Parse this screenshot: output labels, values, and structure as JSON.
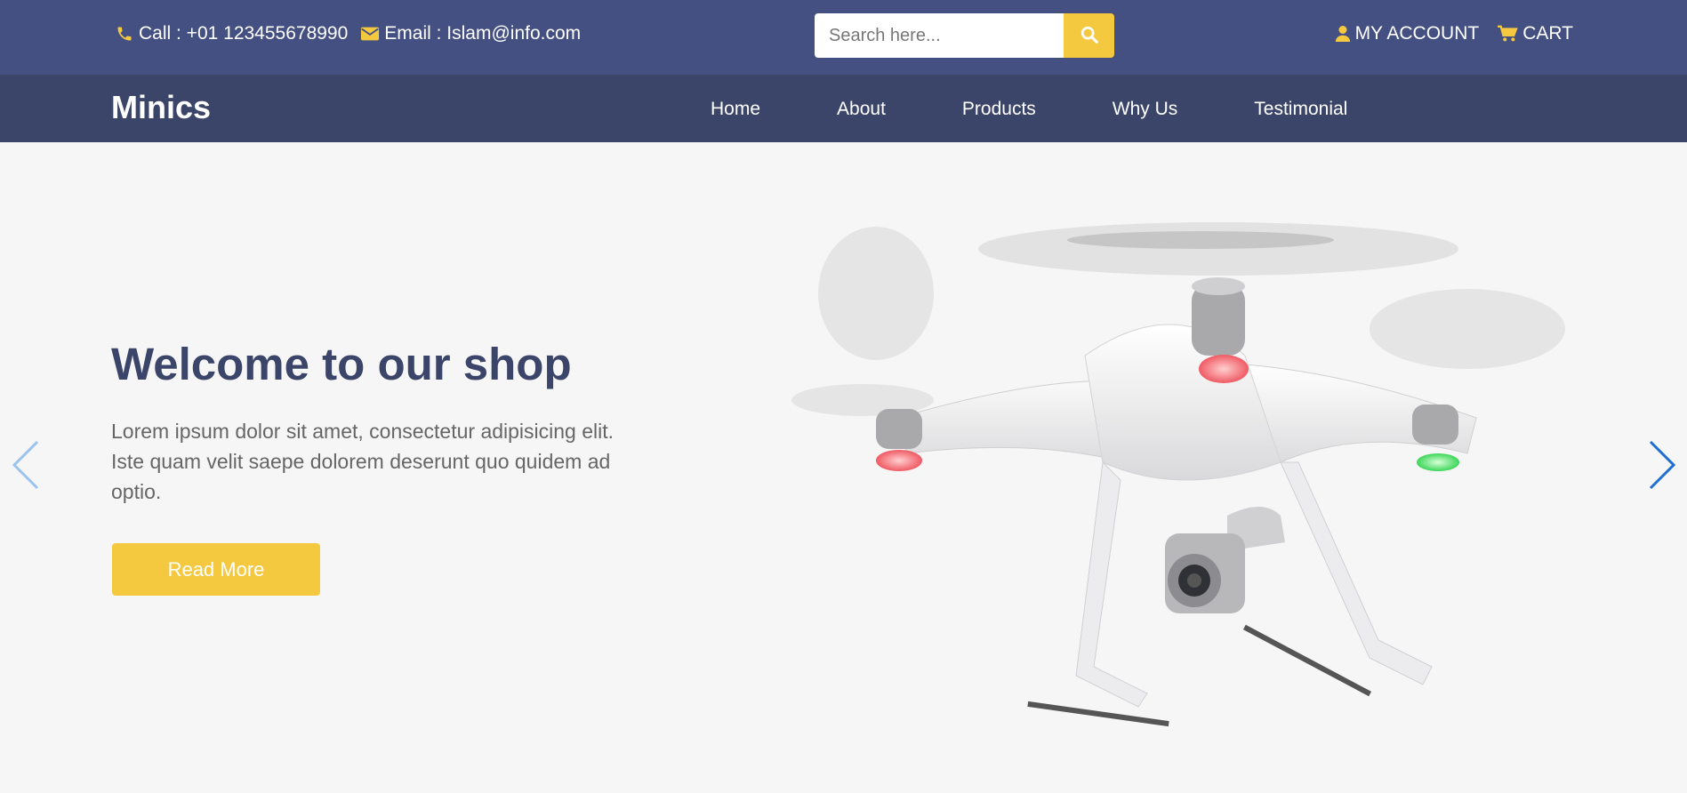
{
  "topbar": {
    "phone_label": "Call : +01 123455678990",
    "email_label": "Email : Islam@info.com",
    "search_placeholder": "Search here...",
    "account_label": "MY ACCOUNT",
    "cart_label": "CART"
  },
  "nav": {
    "brand": "Minics",
    "links": [
      "Home",
      "About",
      "Products",
      "Why Us",
      "Testimonial"
    ]
  },
  "hero": {
    "title": "Welcome to our shop",
    "body": "Lorem ipsum dolor sit amet, consectetur adipisicing elit. Iste quam velit saepe dolorem deserunt quo quidem ad optio.",
    "button_label": "Read More"
  },
  "colors": {
    "topbar": "#445082",
    "navbar": "#3b4569",
    "accent": "#f5c93f",
    "heading": "#3b4569"
  },
  "icons": [
    "phone-icon",
    "envelope-icon",
    "search-icon",
    "user-icon",
    "cart-icon",
    "chevron-left-icon",
    "chevron-right-icon"
  ]
}
